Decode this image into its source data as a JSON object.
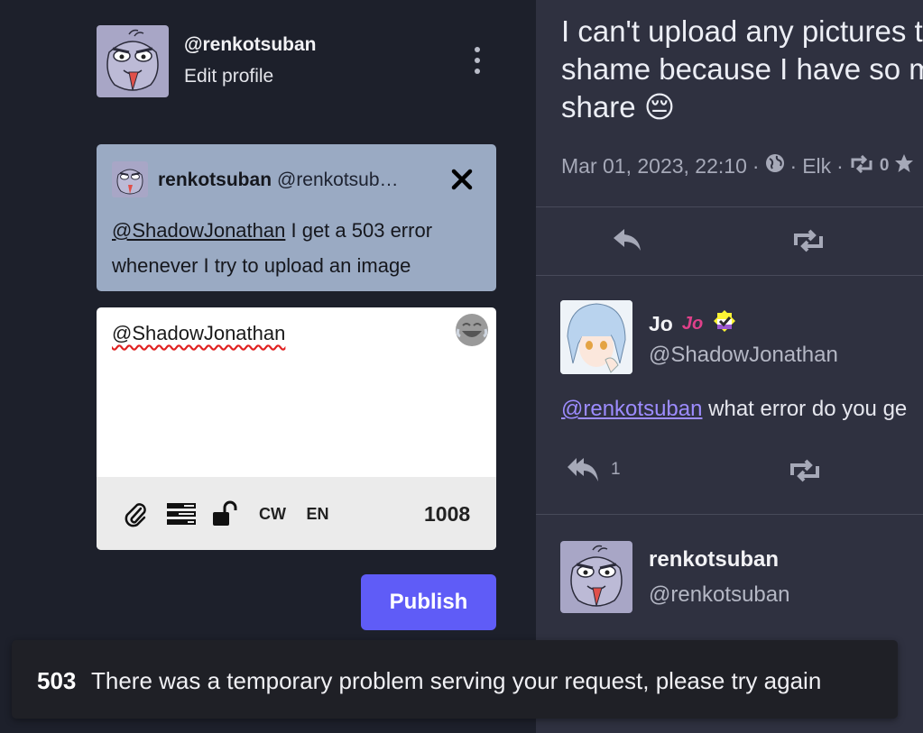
{
  "account": {
    "handle": "@renkotsuban",
    "edit_label": "Edit profile"
  },
  "reply_to": {
    "name": "renkotsuban",
    "acct": "@renkotsuban@...",
    "mention": "@ShadowJonathan",
    "text": " I get a 503 error whenever I try to upload an image"
  },
  "composer": {
    "text": "@ShadowJonathan",
    "toolbar": {
      "cw_label": "CW",
      "lang_label": "EN"
    },
    "char_count": "1008"
  },
  "publish_label": "Publish",
  "status": {
    "line1": "I can't upload any pictures to",
    "line2": "shame because I have so m",
    "line3": "share",
    "emoji": "😔",
    "date": "Mar 01, 2023, 22:10",
    "separator": "·",
    "app": "Elk",
    "boosts": "0"
  },
  "reply_post": {
    "name": "Jo",
    "badge": "Jo",
    "handle": "@ShadowJonathan",
    "mention": "@renkotsuban",
    "text": " what error do you ge",
    "reply_count": "1"
  },
  "next_post": {
    "name": "renkotsuban",
    "handle": "@renkotsuban"
  },
  "toast": {
    "code": "503",
    "message": "There was a temporary problem serving your request, please try again"
  },
  "colors": {
    "accent": "#5f5cf7",
    "reply_card": "#9aaac3",
    "mention": "#9d8cff"
  }
}
